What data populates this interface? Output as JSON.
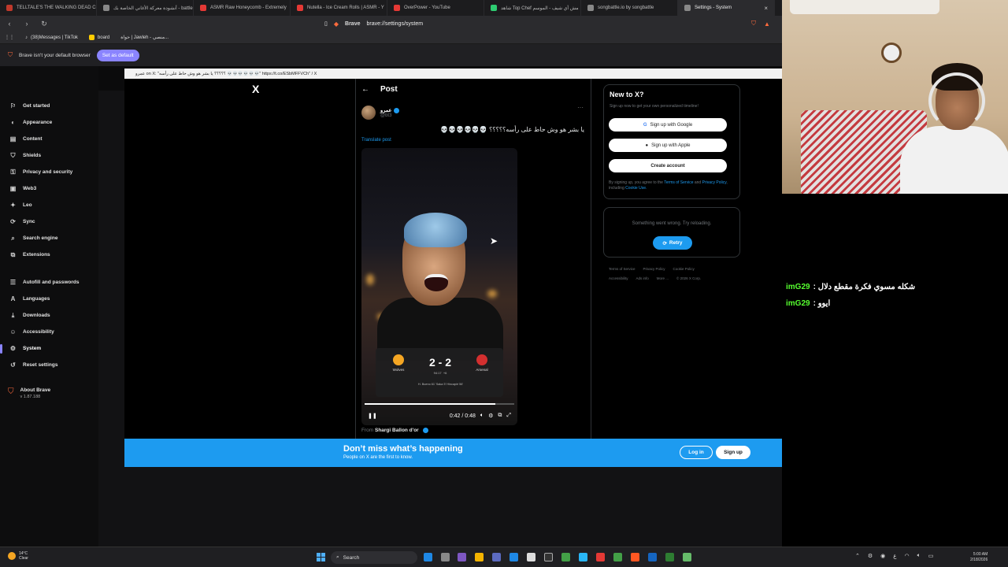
{
  "tabs": [
    {
      "title": "TELLTALE'S THE WALKING DEAD Co",
      "color": "#c0392b"
    },
    {
      "title": "أنشودة معركة الأغاني الخاصة بك - battle",
      "color": "#888888"
    },
    {
      "title": "ASMR Raw Honeycomb - Extremely",
      "color": "#e53935"
    },
    {
      "title": "Nutella - Ice Cream Rolls | ASMR - Y",
      "color": "#e53935"
    },
    {
      "title": "OverPower - YouTube",
      "color": "#e53935"
    },
    {
      "title": "شاهد Top Chef مش أي شيف - الموسم",
      "color": "#2ecc71"
    },
    {
      "title": "songbattle.io by songbattle",
      "color": "#888888"
    },
    {
      "title": "Settings - System",
      "color": "#888888"
    }
  ],
  "address": {
    "brand": "Brave",
    "url": "brave://settings/system"
  },
  "bookmarks": [
    "(38)Messages | TikTok",
    "board",
    "حواة | Jawleh - منصي..."
  ],
  "infobar": {
    "message": "Brave isn't your default browser",
    "button": "Set as default"
  },
  "sidebar": {
    "items": [
      {
        "label": "Get started",
        "icon": "⚐"
      },
      {
        "label": "Appearance",
        "icon": "◐"
      },
      {
        "label": "Content",
        "icon": "▤"
      },
      {
        "label": "Shields",
        "icon": "⛉"
      },
      {
        "label": "Privacy and security",
        "icon": "⚿"
      },
      {
        "label": "Web3",
        "icon": "▣"
      },
      {
        "label": "Leo",
        "icon": "✦"
      },
      {
        "label": "Sync",
        "icon": "⟳"
      },
      {
        "label": "Search engine",
        "icon": "⌕"
      },
      {
        "label": "Extensions",
        "icon": "⧉"
      },
      {
        "label": "Autofill and passwords",
        "icon": "☰"
      },
      {
        "label": "Languages",
        "icon": "A"
      },
      {
        "label": "Downloads",
        "icon": "⤓"
      },
      {
        "label": "Accessibility",
        "icon": "☺"
      },
      {
        "label": "System",
        "icon": "⚙"
      },
      {
        "label": "Reset settings",
        "icon": "↺"
      }
    ],
    "about": {
      "title": "About Brave",
      "version": "v 1.87.188"
    }
  },
  "popup": {
    "title": "عمرو on X: \"؟؟؟؟؟ يا بشر هو وش حاط على رأسه 💀💀💀💀💀💀\" https://t.co/ESbMFFVCh\" / X",
    "logo": "X",
    "post_header": "Post",
    "author_name": "عمرو",
    "author_handle": "@bt3",
    "tweet_text": "يا بشر هو وش حاط على رأسه؟؟؟؟؟ 💀💀💀💀💀💀",
    "translate": "Translate post",
    "video": {
      "home_team": "Wolves",
      "away_team": "Arsenal",
      "score": "2 - 2",
      "minute": "94:17",
      "added": "+6",
      "scorers": "H. Bueno 61'   Saka 5' Hincapié 56'",
      "time": "0:42 / 0:48",
      "progress": 0.875
    },
    "from_label": "From",
    "from_name": "Shargi Ballon d'or"
  },
  "newx": {
    "title": "New to X?",
    "subtitle": "Sign up now to get your own personalized timeline!",
    "google": "Sign up with Google",
    "apple": "Sign up with Apple",
    "create": "Create account",
    "terms_prefix": "By signing up, you agree to the",
    "terms": "Terms of Service",
    "and": "and",
    "privacy": "Privacy Policy",
    "including": ", including",
    "cookie": "Cookie Use."
  },
  "error": {
    "message": "Something went wrong. Try reloading.",
    "retry": "Retry"
  },
  "footer": [
    "Terms of Service",
    "Privacy Policy",
    "Cookie Policy",
    "Accessibility",
    "Ads info",
    "More ...",
    "© 2026 X Corp."
  ],
  "banner": {
    "title": "Don’t miss what’s happening",
    "subtitle": "People on X are the first to know.",
    "login": "Log in",
    "signup": "Sign up"
  },
  "chat": [
    {
      "user": "imG29",
      "message": ": شكله مسوي فكرة مقطع دلال"
    },
    {
      "user": "imG29",
      "message": ": ايوو"
    }
  ],
  "taskbar": {
    "weather_temp": "14°C",
    "weather_desc": "Clear",
    "search": "Search",
    "time": "5:00 AM",
    "date": "2/18/2026"
  },
  "colors": {
    "accent": "#8a84ff",
    "x_blue": "#1d9bf0",
    "chat_user": "#56ff2f"
  }
}
